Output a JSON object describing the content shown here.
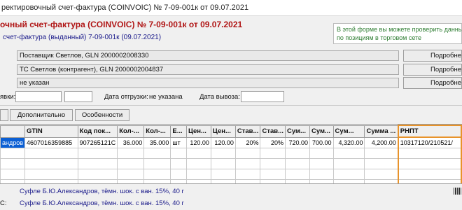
{
  "window": {
    "title": "ректировочный счет-фактура (COINVOIC) № 7-09-001к от 09.07.2021"
  },
  "document": {
    "title": "очный счет-фактура (COINVOIC) № 7-09-001к от 09.07.2021",
    "subtitle": "счет-фактура (выданный) 7-09-001к (09.07.2021)",
    "hint": "В этой форме вы можете проверить данны\nпо позициям в торговом сете"
  },
  "parties": [
    {
      "value": "Поставщик Светлов, GLN 2000002008330",
      "button": "Подробне"
    },
    {
      "value": "ТС Светлов (контрагент), GLN 2000002004837",
      "button": "Подробне"
    },
    {
      "value": "не указан",
      "button": "Подробне"
    }
  ],
  "dates": {
    "left_label": "явки:",
    "shipment_label": "Дата отгрузки:",
    "shipment_value": "не указана",
    "export_label": "Дата вывоза:"
  },
  "buttons": {
    "additional": "Дополнительно",
    "features": "Особенности"
  },
  "table": {
    "columns": [
      "",
      "GTIN",
      "Код пок...",
      "Кол-...",
      "Кол-...",
      "Е...",
      "Цен...",
      "Цен...",
      "Став...",
      "Став...",
      "Сум...",
      "Сум...",
      "Сум...",
      "Сумма ...",
      "РНПТ"
    ],
    "rows": [
      [
        "андров",
        "4607016359885",
        "907265121C",
        "36.000",
        "35.000",
        "шт",
        "120.00",
        "120.00",
        "20%",
        "20%",
        "720.00",
        "700.00",
        "4,320.00",
        "4,200.00",
        "10317120/210521/"
      ]
    ]
  },
  "footer": {
    "line1": "Суфле Б.Ю.Александров, тёмн. шок. с ван. 15%, 40 г",
    "line2": "Суфле Б.Ю.Александров, тёмн. шок. с ван. 15%, 40 г",
    "line2_prefix": "С:"
  }
}
